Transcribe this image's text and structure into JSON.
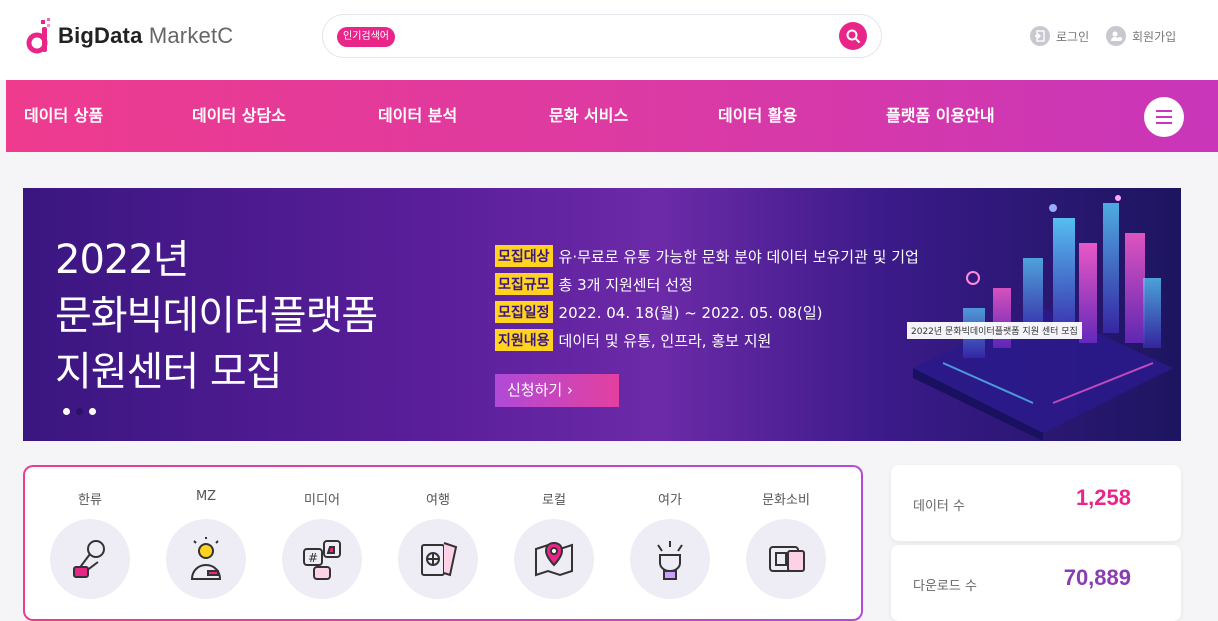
{
  "brand": {
    "name_bold": "BigData",
    "name_rest": " MarketC"
  },
  "search": {
    "tag": "인기검색어",
    "value": "",
    "placeholder": ""
  },
  "util": {
    "login": "로그인",
    "join": "회원가입"
  },
  "nav": {
    "items": [
      "데이터 상품",
      "데이터 상담소",
      "데이터 분석",
      "문화 서비스",
      "데이터 활용",
      "플랫폼 이용안내"
    ]
  },
  "banner": {
    "title_lines": [
      "2022년",
      "문화빅데이터플랫폼",
      "지원센터 모집"
    ],
    "info": [
      {
        "tag": "모집대상",
        "text": "유·무료로 유통 가능한 문화 분야 데이터 보유기관 및 기업"
      },
      {
        "tag": "모집규모",
        "text": "총 3개 지원센터 선정"
      },
      {
        "tag": "모집일정",
        "text": "2022. 04. 18(월) ~ 2022. 05. 08(일)"
      },
      {
        "tag": "지원내용",
        "text": "데이터 및 유통, 인프라, 홍보 지원"
      }
    ],
    "apply_label": "신청하기  ›",
    "caption": "2022년 문화빅데이터플랫폼 지원 센터 모집",
    "active_dot": 1
  },
  "categories": [
    "한류",
    "MZ",
    "미디어",
    "여행",
    "로컬",
    "여가",
    "문화소비"
  ],
  "stats": [
    {
      "label": "데이터 수",
      "value": "1,258",
      "color": "#e8268a"
    },
    {
      "label": "다운로드 수",
      "value": "70,889",
      "color": "#8a3db0"
    }
  ],
  "colors": {
    "accent": "#e8268a",
    "purple": "#c936b9",
    "tag_yellow": "#ffd320"
  }
}
